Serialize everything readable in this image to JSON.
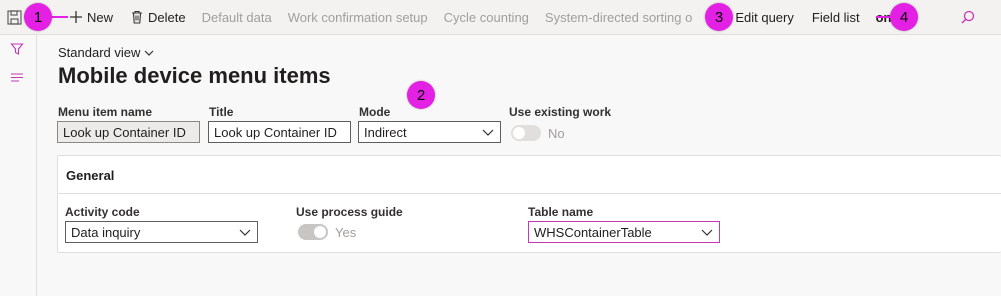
{
  "toolbar": {
    "new_label": "New",
    "delete_label": "Delete",
    "default_data_label": "Default data",
    "work_confirmation_label": "Work confirmation setup",
    "cycle_counting_label": "Cycle counting",
    "system_directed_label": "System-directed sorting o",
    "edit_query_label": "Edit query",
    "field_list_label": "Field list",
    "options_label": "ons",
    "icons": [
      "save-icon",
      "add-icon",
      "delete-icon",
      "search-icon"
    ]
  },
  "markers": [
    "1",
    "2",
    "3",
    "4"
  ],
  "marker_color": "#e320e3",
  "rail": {
    "icons": [
      "filter-icon",
      "list-icon"
    ]
  },
  "page": {
    "view_label": "Standard view",
    "title": "Mobile device menu items"
  },
  "form": {
    "menu_item_name": {
      "label": "Menu item name",
      "value": "Look up Container ID"
    },
    "title": {
      "label": "Title",
      "value": "Look up Container ID"
    },
    "mode": {
      "label": "Mode",
      "value": "Indirect"
    },
    "use_existing_work": {
      "label": "Use existing work",
      "value": "No",
      "on": false
    }
  },
  "general": {
    "title": "General",
    "activity_code": {
      "label": "Activity code",
      "value": "Data inquiry"
    },
    "use_process_guide": {
      "label": "Use process guide",
      "value": "Yes",
      "on": true
    },
    "table_name": {
      "label": "Table name",
      "value": "WHSContainerTable"
    }
  },
  "colors": {
    "accent": "#c239b3",
    "marker": "#e320e3",
    "toolbar_bg": "#f3f2f1"
  }
}
